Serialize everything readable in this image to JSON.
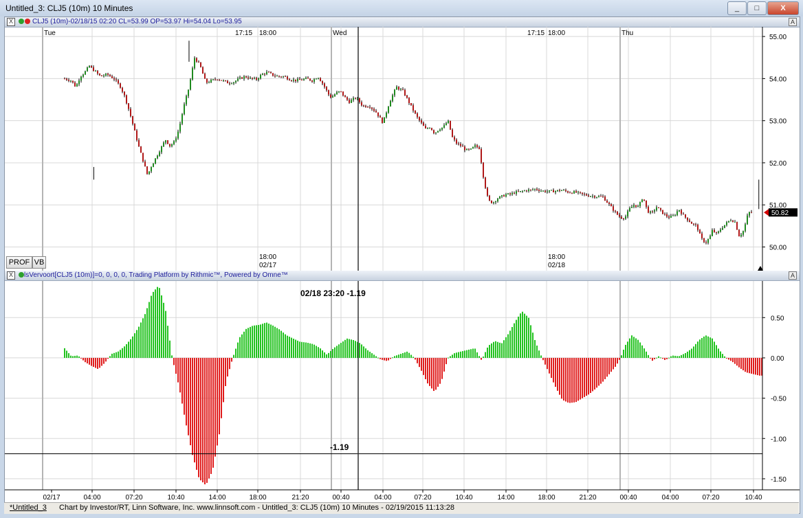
{
  "window": {
    "title": "Untitled_3: CLJ5 (10m) 10 Minutes",
    "minimize": "_",
    "maximize": "□",
    "close": "X"
  },
  "price_header": {
    "close_box": "X",
    "text": "CLJ5 (10m)-02/18/15 02:20 CL=53.99 OP=53.97 Hi=54.04 Lo=53.95",
    "autoscale": "A"
  },
  "indicator_header": {
    "close_box": "X",
    "text": "lsVervoort[CLJ5 (10m)]=0, 0, 0, 0,   Trading Platform by Rithmic™, Powered by Omne™",
    "autoscale": "A"
  },
  "buttons": {
    "prof": "PROF",
    "vb": "VB"
  },
  "cursor": {
    "readout": "02/18 23:20  -1.19",
    "hline_label": "-1.19"
  },
  "status": {
    "tab": "*Untitled_3",
    "text": "Chart by Investor/RT, Linn Software, Inc. www.linnsoft.com - Untitled_3: CLJ5 (10m) 10 Minutes - 02/19/2015 11:13:28"
  },
  "colors": {
    "up": "#21c21e",
    "down": "#e01c1c",
    "bull_candle": "#1f8a1f",
    "bear_candle": "#b01818",
    "last_price": "#d00000"
  },
  "chart_data": [
    {
      "type": "candlestick",
      "title": "CLJ5 (10m)",
      "ylim": [
        49.6,
        55.1
      ],
      "y_ticks": [
        "55.00",
        "54.00",
        "53.00",
        "52.00",
        "51.00",
        "50.00"
      ],
      "last_price": "50.82",
      "day_labels": [
        "Tue",
        "Wed",
        "Thu"
      ],
      "session_labels": [
        "17:15",
        "18:00",
        "17:15",
        "18:00"
      ],
      "session_date_labels": [
        {
          "time": "18:00",
          "date": "02/17"
        },
        {
          "time": "18:00",
          "date": "02/18"
        }
      ],
      "x": [
        0,
        6,
        10,
        14,
        18,
        22,
        26,
        32,
        38,
        44,
        50,
        54,
        58,
        62,
        66,
        70,
        74,
        77,
        81,
        85,
        90,
        94,
        98,
        102,
        106,
        111,
        116,
        121,
        126,
        131,
        136,
        141,
        146,
        151,
        156,
        161,
        166,
        171,
        176,
        181,
        186,
        191,
        196,
        201,
        206,
        211,
        216,
        221,
        226,
        231,
        236,
        238,
        242,
        246,
        250,
        254,
        260,
        266,
        272,
        278,
        284,
        290,
        296,
        302,
        308,
        314,
        318,
        322,
        326,
        330,
        334,
        338,
        342,
        346,
        350,
        354,
        358,
        362,
        366,
        370,
        374,
        378,
        382,
        386,
        390,
        394,
        398,
        402,
        404,
        408,
        412,
        416,
        420,
        426,
        432,
        438,
        444,
        450,
        456,
        462,
        468,
        474,
        480,
        486,
        492,
        496,
        500,
        504,
        508,
        512,
        516,
        520,
        524,
        528,
        532,
        536,
        540,
        544,
        548,
        552,
        556,
        560,
        564,
        568,
        572,
        576,
        578,
        582,
        586,
        590,
        594,
        598,
        602,
        606,
        610,
        614,
        618,
        622
      ],
      "close": [
        54.0,
        53.95,
        53.8,
        54.05,
        54.15,
        54.3,
        54.2,
        54.05,
        54.1,
        54.0,
        53.8,
        53.55,
        53.2,
        52.8,
        52.4,
        52.05,
        51.7,
        51.9,
        52.1,
        52.3,
        52.55,
        52.4,
        52.5,
        52.8,
        53.3,
        53.8,
        54.5,
        54.3,
        53.9,
        53.95,
        54.0,
        53.95,
        53.9,
        53.92,
        54.0,
        54.05,
        54.0,
        53.98,
        54.1,
        54.15,
        54.08,
        54.05,
        54.05,
        53.98,
        53.96,
        53.97,
        54.0,
        53.95,
        54.05,
        53.85,
        53.6,
        53.55,
        53.65,
        53.7,
        53.55,
        53.45,
        53.55,
        53.35,
        53.35,
        53.2,
        52.95,
        53.45,
        53.8,
        53.7,
        53.4,
        53.1,
        52.95,
        52.8,
        52.85,
        52.7,
        52.8,
        52.85,
        53.0,
        52.6,
        52.45,
        52.4,
        52.3,
        52.3,
        52.4,
        52.35,
        51.6,
        51.1,
        51.05,
        51.15,
        51.2,
        51.25,
        51.25,
        51.3,
        51.3,
        51.32,
        51.35,
        51.35,
        51.38,
        51.33,
        51.32,
        51.33,
        51.35,
        51.3,
        51.3,
        51.25,
        51.22,
        51.2,
        51.2,
        51.0,
        50.8,
        50.7,
        50.7,
        50.9,
        51.0,
        50.95,
        51.2,
        50.85,
        50.8,
        50.95,
        50.85,
        50.75,
        50.7,
        50.75,
        50.9,
        50.75,
        50.65,
        50.55,
        50.5,
        50.2,
        50.1,
        50.25,
        50.4,
        50.3,
        50.45,
        50.55,
        50.65,
        50.6,
        50.25,
        50.4,
        50.82,
        50.82
      ],
      "annotation": "price falls from about 54.0 on Tue to 50.82 on Thu, low near 49.85"
    },
    {
      "type": "histogram",
      "title": "lsVervoort",
      "ylim": [
        -1.62,
        0.92
      ],
      "y_ticks": [
        "0.50",
        "0.00",
        "-0.50",
        "-1.00",
        "-1.50"
      ],
      "x_ticks": [
        "02/17",
        "04:00",
        "07:20",
        "10:40",
        "14:00",
        "18:00",
        "21:20",
        "00:40",
        "04:00",
        "07:20",
        "10:40",
        "14:00",
        "18:00",
        "21:20",
        "00:40",
        "04:00",
        "07:20",
        "10:40"
      ],
      "x": [
        0,
        6,
        12,
        18,
        24,
        30,
        36,
        42,
        48,
        54,
        60,
        66,
        72,
        78,
        84,
        90,
        96,
        102,
        108,
        114,
        120,
        126,
        132,
        138,
        144,
        150,
        156,
        162,
        168,
        174,
        180,
        186,
        192,
        198,
        204,
        210,
        216,
        222,
        228,
        234,
        240,
        246,
        252,
        258,
        264,
        270,
        276,
        282,
        288,
        294,
        300,
        306,
        312,
        318,
        324,
        330,
        336,
        342,
        348,
        354,
        360,
        366,
        372,
        378,
        384,
        390,
        396,
        402,
        408,
        414,
        420,
        426,
        432,
        438,
        444,
        450,
        456,
        462,
        468,
        474,
        480,
        486,
        492,
        496,
        500,
        506,
        512,
        518,
        524,
        530,
        536,
        542,
        548,
        554,
        560,
        566,
        572,
        578,
        584,
        590,
        596,
        602,
        608,
        614,
        620,
        622
      ],
      "values": [
        0.12,
        0.02,
        0.03,
        -0.05,
        -0.1,
        -0.14,
        -0.06,
        0.05,
        0.08,
        0.15,
        0.25,
        0.38,
        0.55,
        0.8,
        0.9,
        0.6,
        0.0,
        -0.35,
        -0.8,
        -1.2,
        -1.5,
        -1.58,
        -1.4,
        -0.95,
        -0.3,
        0.0,
        0.25,
        0.36,
        0.4,
        0.41,
        0.44,
        0.4,
        0.35,
        0.28,
        0.24,
        0.2,
        0.19,
        0.17,
        0.12,
        0.04,
        0.12,
        0.18,
        0.24,
        0.22,
        0.18,
        0.1,
        0.04,
        -0.02,
        -0.04,
        0.02,
        0.05,
        0.08,
        0.0,
        -0.15,
        -0.32,
        -0.42,
        -0.3,
        0.0,
        0.06,
        0.08,
        0.1,
        0.12,
        -0.03,
        0.15,
        0.21,
        0.18,
        0.3,
        0.45,
        0.58,
        0.5,
        0.2,
        0.0,
        -0.18,
        -0.36,
        -0.52,
        -0.56,
        -0.55,
        -0.5,
        -0.45,
        -0.38,
        -0.3,
        -0.2,
        -0.1,
        0.0,
        0.15,
        0.28,
        0.22,
        0.1,
        -0.04,
        0.02,
        -0.03,
        0.03,
        0.02,
        0.06,
        0.12,
        0.22,
        0.28,
        0.24,
        0.1,
        0.0,
        -0.05,
        -0.12,
        -0.18,
        -0.2,
        -0.22,
        -0.22
      ],
      "cursor_value": -1.19
    }
  ]
}
